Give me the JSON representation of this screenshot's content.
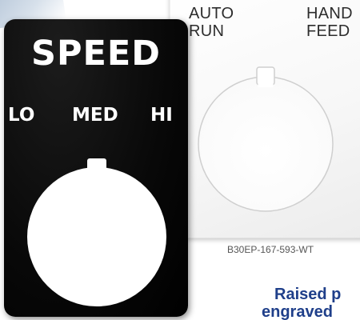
{
  "white_plate": {
    "top_left_label_line1": "AUTO",
    "top_left_label_line2": "RUN",
    "top_right_label_line1": "HAND",
    "top_right_label_line2": "FEED"
  },
  "black_plate": {
    "title": "SPEED",
    "left_label": "LO",
    "center_label": "MED",
    "right_label": "HI"
  },
  "part_number": "B30EP-167-593-WT",
  "caption": {
    "line1": "Raised p",
    "line2": "engraved"
  },
  "colors": {
    "black_plate": "#000000",
    "white_plate": "#f5f5f5",
    "caption_blue": "#1f3f8a",
    "legend_white": "#ffffff",
    "legend_gray": "#2d2d2d"
  }
}
